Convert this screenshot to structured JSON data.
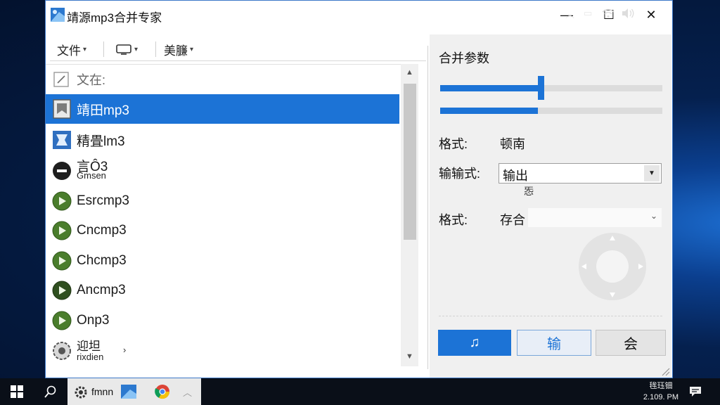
{
  "window": {
    "title": "靖源mp3合并专家",
    "controls": {
      "minimize": "—",
      "maximize": "☐",
      "close": "✕"
    }
  },
  "toolbar": {
    "file_label": "文件",
    "file_caret": "▾",
    "view_caret": "▾",
    "beauty_label": "美臁",
    "beauty_caret": "▾"
  },
  "file_list": {
    "header_label": "文在:",
    "rows": [
      {
        "label": "靖田mp3",
        "icon": "document-icon",
        "selected": true
      },
      {
        "label": "精畳lm3",
        "icon": "blue-box-icon",
        "selected": false
      },
      {
        "label": "言Ô3",
        "sub": "Gmsen",
        "icon": "black-disc-icon",
        "selected": false
      },
      {
        "label": "Esrcmp3",
        "icon": "green-play-icon",
        "selected": false
      },
      {
        "label": "Cncmp3",
        "icon": "green-play-icon",
        "selected": false
      },
      {
        "label": "Chcmp3",
        "icon": "green-play-icon",
        "selected": false
      },
      {
        "label": "Ancmp3",
        "icon": "dark-green-play-icon",
        "selected": false
      },
      {
        "label": "Onp3",
        "icon": "green-play-icon",
        "selected": false
      },
      {
        "label": "迎坦",
        "sub": "rixdien",
        "icon": "gear-icon",
        "selected": false
      }
    ]
  },
  "params": {
    "group_title": "合并参数",
    "slider1_level": 0.44,
    "slider2_level": 0.44,
    "format_label": "格式:",
    "format_value": "顿南",
    "output_label": "输输式:",
    "output_value": "输出",
    "output_under": "㤅",
    "format2_label": "格式:",
    "format2_value": "存合",
    "format2_caret": "⌄"
  },
  "buttons": {
    "music_label": "♫",
    "output_label": "输",
    "meet_label": "会"
  },
  "taskbar": {
    "app_label": "fmnn",
    "clock_line1": "毪珏钿",
    "clock_line2": "2.109. PM"
  },
  "colors": {
    "accent": "#1c73d6",
    "window_border": "#3c78c8",
    "panel_bg": "#f0f0f0",
    "taskbar_bg": "#0a0f18"
  }
}
